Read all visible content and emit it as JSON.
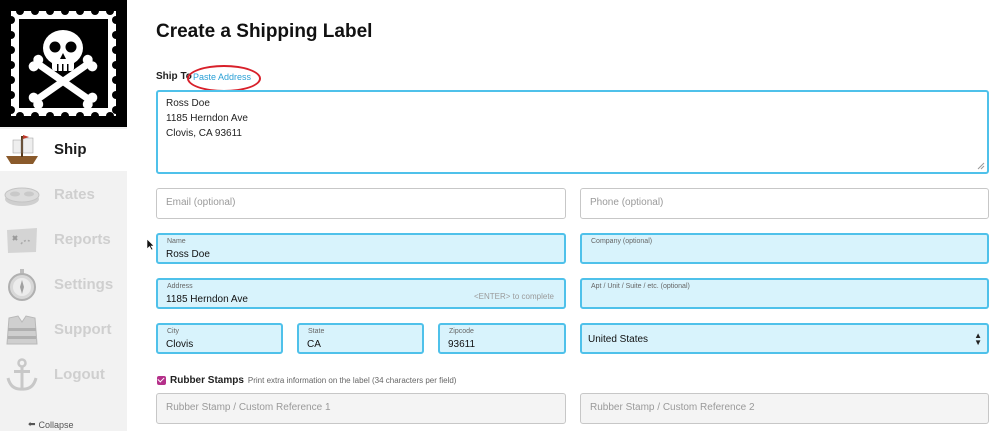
{
  "sidebar": {
    "items": [
      {
        "label": "Ship",
        "icon": "ship-icon",
        "active": true
      },
      {
        "label": "Rates",
        "icon": "coins-icon",
        "active": false
      },
      {
        "label": "Reports",
        "icon": "treasure-map-icon",
        "active": false
      },
      {
        "label": "Settings",
        "icon": "compass-icon",
        "active": false
      },
      {
        "label": "Support",
        "icon": "life-vest-icon",
        "active": false
      },
      {
        "label": "Logout",
        "icon": "anchor-icon",
        "active": false
      }
    ],
    "collapse_label": "Collapse"
  },
  "main": {
    "title": "Create a Shipping Label",
    "ship_to_label": "Ship To",
    "paste_address_link": "Paste Address",
    "address_text": {
      "line1": "Ross Doe",
      "line2": "1185 Herndon Ave",
      "line3": "Clovis, CA 93611"
    },
    "email": {
      "placeholder": "Email (optional)",
      "value": ""
    },
    "phone": {
      "placeholder": "Phone (optional)",
      "value": ""
    },
    "name": {
      "label": "Name",
      "value": "Ross Doe"
    },
    "company": {
      "label": "Company (optional)",
      "value": ""
    },
    "address": {
      "label": "Address",
      "value": "1185 Herndon Ave",
      "hint": "<ENTER> to complete"
    },
    "apt": {
      "label": "Apt / Unit / Suite / etc. (optional)",
      "value": ""
    },
    "city": {
      "label": "City",
      "value": "Clovis"
    },
    "state": {
      "label": "State",
      "value": "CA"
    },
    "zipcode": {
      "label": "Zipcode",
      "value": "93611"
    },
    "country": {
      "value": "United States"
    },
    "rubber_stamps": {
      "checked": true,
      "title": "Rubber Stamps",
      "description": "Print extra information on the label (34 characters per field)",
      "field1_placeholder": "Rubber Stamp / Custom Reference 1",
      "field2_placeholder": "Rubber Stamp / Custom Reference 2"
    }
  },
  "colors": {
    "accent": "#4fc1ea",
    "filled_bg": "#d8f3fc",
    "checkbox": "#b5308a",
    "annotation": "#d8202a",
    "link": "#2aa0d6"
  }
}
